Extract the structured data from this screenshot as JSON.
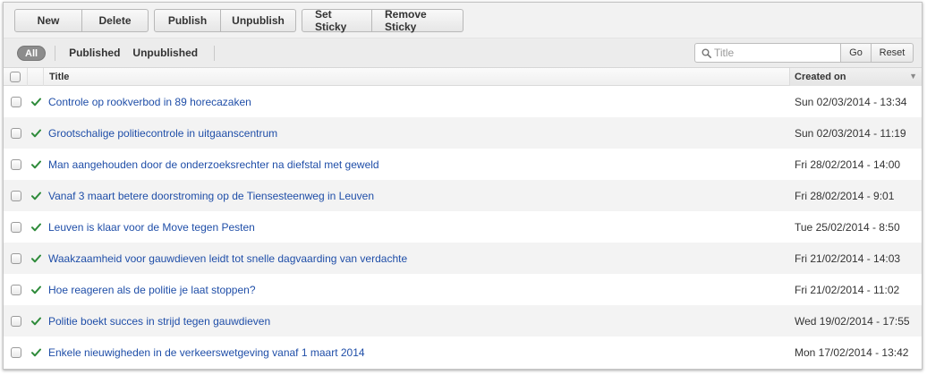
{
  "toolbar": {
    "new_label": "New",
    "delete_label": "Delete",
    "publish_label": "Publish",
    "unpublish_label": "Unpublish",
    "set_sticky_label": "Set Sticky",
    "remove_sticky_label": "Remove Sticky"
  },
  "filters": {
    "all_label": "All",
    "published_label": "Published",
    "unpublished_label": "Unpublished"
  },
  "search": {
    "placeholder": "Title",
    "go_label": "Go",
    "reset_label": "Reset"
  },
  "table": {
    "columns": {
      "title": "Title",
      "created": "Created on"
    },
    "rows": [
      {
        "title": "Controle op rookverbod in 89 horecazaken",
        "created": "Sun 02/03/2014 - 13:34"
      },
      {
        "title": "Grootschalige politiecontrole in uitgaanscentrum",
        "created": "Sun 02/03/2014 - 11:19"
      },
      {
        "title": "Man aangehouden door de onderzoeksrechter na diefstal met geweld",
        "created": "Fri 28/02/2014 - 14:00"
      },
      {
        "title": "Vanaf 3 maart betere doorstroming op de Tiensesteenweg in Leuven",
        "created": "Fri 28/02/2014 - 9:01"
      },
      {
        "title": "Leuven is klaar voor de Move tegen Pesten",
        "created": "Tue 25/02/2014 - 8:50"
      },
      {
        "title": "Waakzaamheid voor gauwdieven leidt tot snelle dagvaarding van verdachte",
        "created": "Fri 21/02/2014 - 14:03"
      },
      {
        "title": "Hoe reageren als de politie je laat stoppen?",
        "created": "Fri 21/02/2014 - 11:02"
      },
      {
        "title": "Politie boekt succes in strijd tegen gauwdieven",
        "created": "Wed 19/02/2014 - 17:55"
      },
      {
        "title": "Enkele nieuwigheden in de verkeerswetgeving vanaf 1 maart 2014",
        "created": "Mon 17/02/2014 - 13:42"
      }
    ]
  },
  "colors": {
    "link": "#1f4ea8",
    "check": "#2e8b3a"
  }
}
